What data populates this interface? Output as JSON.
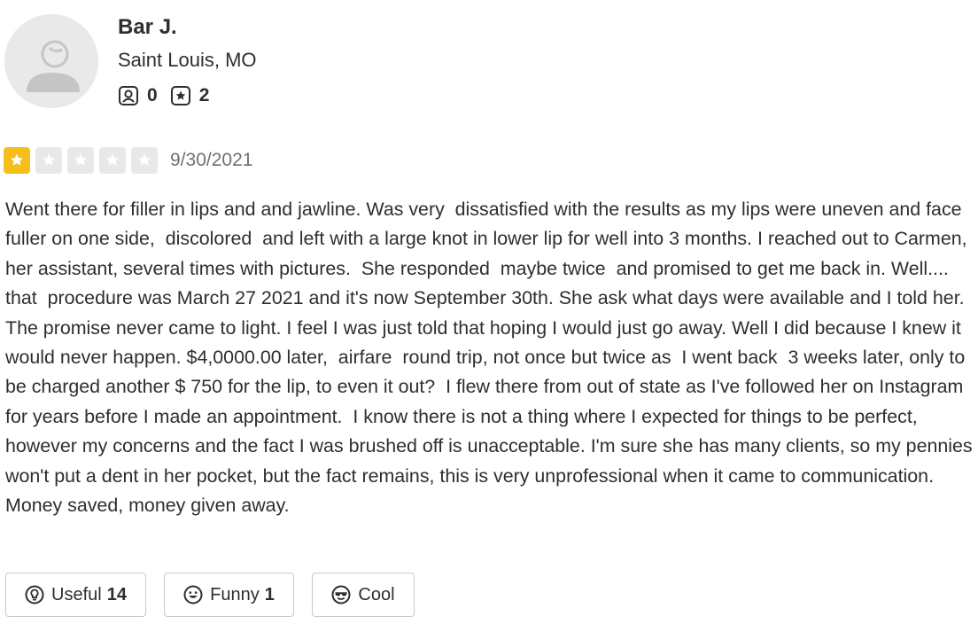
{
  "reviewer": {
    "name": "Bar J.",
    "location": "Saint Louis, MO",
    "friends_count": "0",
    "reviews_count": "2",
    "friends_icon": "friends-icon",
    "reviews_icon": "review-star-icon",
    "avatar_icon": "default-user-avatar-icon"
  },
  "review": {
    "rating": 1,
    "rating_max": 5,
    "date": "9/30/2021",
    "star_filled_color": "#f5be1b",
    "star_empty_color": "#e8e8e9",
    "text": "Went there for filler in lips and and jawline. Was very  dissatisfied with the results as my lips were uneven and face fuller on one side,  discolored  and left with a large knot in lower lip for well into 3 months. I reached out to Carmen, her assistant, several times with pictures.  She responded  maybe twice  and promised to get me back in. Well.... that  procedure was March 27 2021 and it's now September 30th. She ask what days were available and I told her. The promise never came to light. I feel I was just told that hoping I would just go away. Well I did because I knew it would never happen. $4,0000.00 later,  airfare  round trip, not once but twice as  I went back  3 weeks later, only to be charged another $ 750 for the lip, to even it out?  I flew there from out of state as I've followed her on Instagram for years before I made an appointment.  I know there is not a thing where I expected for things to be perfect, however my concerns and the fact I was brushed off is unacceptable. I'm sure she has many clients, so my pennies won't put a dent in her pocket, but the fact remains, this is very unprofessional when it came to communication. Money saved, money given away."
  },
  "reactions": {
    "useful": {
      "label": "Useful",
      "count": "14",
      "icon": "useful-lightbulb-icon"
    },
    "funny": {
      "label": "Funny",
      "count": "1",
      "icon": "funny-smile-icon"
    },
    "cool": {
      "label": "Cool",
      "count": "",
      "icon": "cool-sunglasses-icon"
    }
  }
}
